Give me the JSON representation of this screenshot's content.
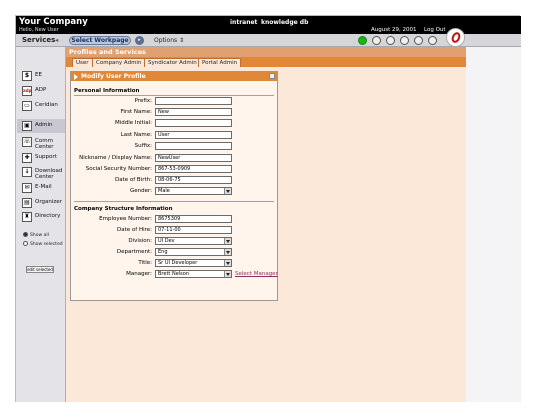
{
  "header": {
    "company": "Your Company",
    "greeting": "Hello, New User",
    "nav": [
      "intranet",
      "knowledge db"
    ],
    "date": "August 29, 2001",
    "logout": "Log Out"
  },
  "toolbar": {
    "services_label": "Services",
    "workpage_label": "Select Workpage",
    "options_label": "Options"
  },
  "sidebar": {
    "items": [
      {
        "label": "EE",
        "icon": "dollar-icon"
      },
      {
        "label": "ADP",
        "icon": "adp-icon"
      },
      {
        "label": "Ceridian",
        "icon": "ceridian-icon"
      },
      {
        "label": "Admin",
        "icon": "admin-icon"
      },
      {
        "label": "Comm Center",
        "icon": "comm-center-icon"
      },
      {
        "label": "Support",
        "icon": "support-icon"
      },
      {
        "label": "Download Center",
        "icon": "download-icon"
      },
      {
        "label": "E-Mail",
        "icon": "email-icon"
      },
      {
        "label": "Organizer",
        "icon": "organizer-icon"
      },
      {
        "label": "Directory",
        "icon": "directory-icon"
      }
    ],
    "show_all": "Show all",
    "show_selected": "Show selected",
    "edit_selected": "edit selected"
  },
  "content": {
    "title": "Profiles and Services",
    "tabs": [
      "User",
      "Company Admin",
      "Syndicator Admin",
      "Portal Admin"
    ]
  },
  "panel": {
    "title": "Modify User Profile",
    "personal_heading": "Personal Information",
    "company_heading": "Company Structure Information",
    "select_manager": "Select Manager",
    "personal_fields": [
      {
        "label": "Prefix:",
        "value": ""
      },
      {
        "label": "First Name:",
        "value": "New"
      },
      {
        "label": "Middle Initial:",
        "value": ""
      },
      {
        "label": "Last Name:",
        "value": "User"
      },
      {
        "label": "Suffix:",
        "value": ""
      },
      {
        "label": "Nickname / Display Name:",
        "value": "NewUser"
      },
      {
        "label": "Social Security Number:",
        "value": "867-53-0909"
      },
      {
        "label": "Date of Birth:",
        "value": "08-06-75"
      },
      {
        "label": "Gender:",
        "value": "Male"
      }
    ],
    "company_fields": [
      {
        "label": "Employee Number:",
        "value": "8675309"
      },
      {
        "label": "Date of Hire:",
        "value": "07-11-00"
      },
      {
        "label": "Division:",
        "value": "UI Dev"
      },
      {
        "label": "Department:",
        "value": "Eng"
      },
      {
        "label": "Title:",
        "value": "Sr UI Developer"
      },
      {
        "label": "Manager:",
        "value": "Brett Nelson"
      }
    ]
  },
  "colors": {
    "accent_orange": "#e08838",
    "panel_bg": "#fbe8d8",
    "link": "#903060"
  }
}
